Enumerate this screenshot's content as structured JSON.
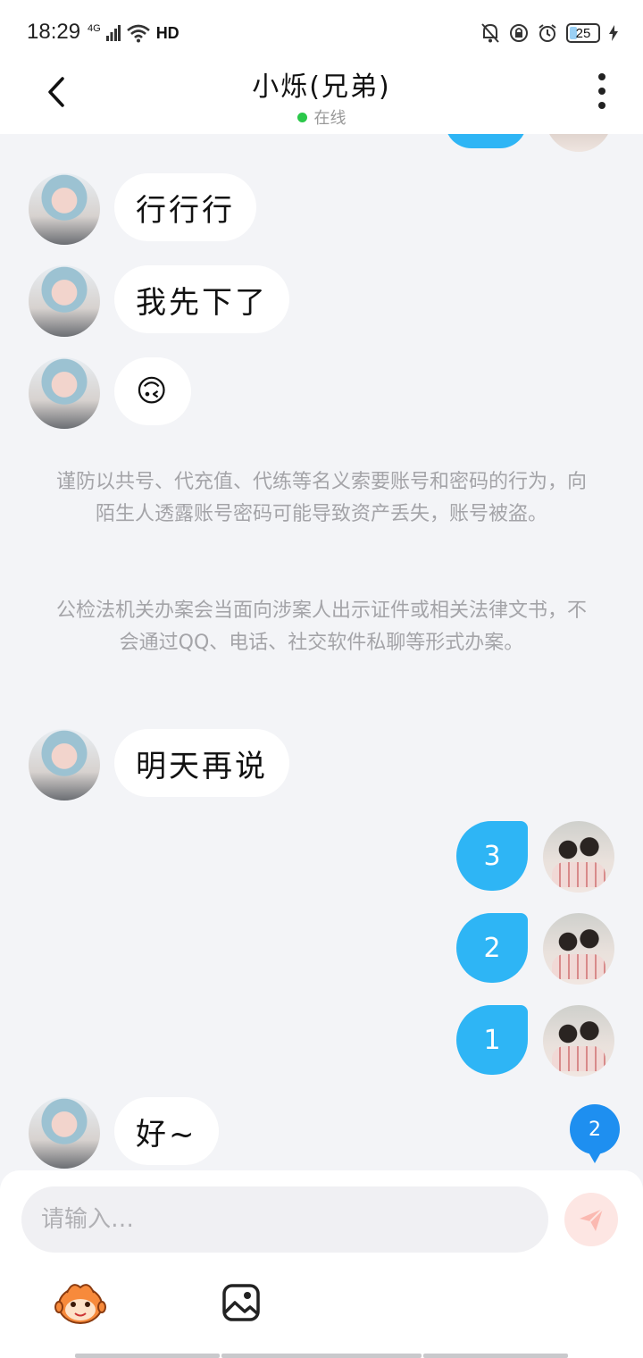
{
  "status_bar": {
    "time": "18:29",
    "network": "4G",
    "wifi_badge": "HD",
    "battery": "25"
  },
  "header": {
    "title": "小烁(兄弟)",
    "presence": "在线",
    "presence_color": "#2bc84a"
  },
  "messages": [
    {
      "side": "in",
      "text": "行行行"
    },
    {
      "side": "in",
      "text": "我先下了"
    },
    {
      "side": "in",
      "text": "🙃"
    },
    {
      "side": "in",
      "text": "明天再说"
    },
    {
      "side": "out",
      "text": "3"
    },
    {
      "side": "out",
      "text": "2"
    },
    {
      "side": "out",
      "text": "1"
    },
    {
      "side": "in",
      "text": "好~"
    }
  ],
  "security_notice": {
    "paragraph_1": "谨防以共号、代充值、代练等名义索要账号和密码的行为，向陌生人透露账号密码可能导致资产丢失，账号被盗。",
    "paragraph_2": "公检法机关办案会当面向涉案人出示证件或相关法律文书，不会通过QQ、电话、社交软件私聊等形式办案。"
  },
  "unread_badge": "2",
  "composer": {
    "placeholder": "请输入…",
    "send_icon": "paper-plane-icon",
    "tools": [
      "mascot-sticker-icon",
      "image-icon"
    ]
  },
  "colors": {
    "outgoing_bubble": "#2eb5f5",
    "badge": "#1e8ff0",
    "send_button_bg": "#fde6e3"
  }
}
